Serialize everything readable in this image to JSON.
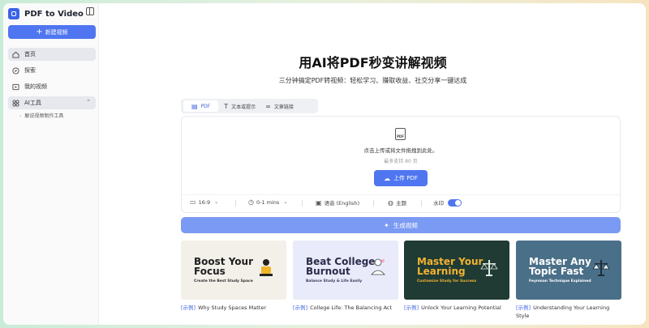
{
  "app": {
    "name": "PDF to Video"
  },
  "sidebar": {
    "new_button": "新建视频",
    "items": [
      {
        "label": "首页",
        "icon": "home-icon"
      },
      {
        "label": "探索",
        "icon": "explore-icon"
      },
      {
        "label": "我的视频",
        "icon": "video-icon"
      },
      {
        "label": "AI工具",
        "icon": "grid-icon"
      }
    ],
    "sub_items": [
      "解说视频制作工具"
    ]
  },
  "hero": {
    "title": "用AI将PDF秒变讲解视频",
    "subtitle": "三分钟搞定PDF转视频：轻松学习、赚取收益、社交分享一键达成"
  },
  "tabs": [
    "PDF",
    "文本或提示",
    "文章链接"
  ],
  "upload": {
    "icon_label": "PDF",
    "drop_text": "点击上传或将文件拖拽到此处。",
    "limit_text": "最多支持 80 页",
    "button": "上传 PDF"
  },
  "options": {
    "ratio": "16:9",
    "duration": "0-1 mins",
    "voice": "语音 (English)",
    "theme": "主题",
    "watermark": "水印",
    "watermark_on": true
  },
  "generate_button": "生成视频",
  "examples": [
    {
      "tag": "[示例]",
      "caption": "Why Study Spaces Matter",
      "thumb_title": "Boost Your Focus",
      "thumb_sub": "Create the Best Study Space"
    },
    {
      "tag": "[示例]",
      "caption": "College Life: The Balancing Act",
      "thumb_title": "Beat College Burnout",
      "thumb_sub": "Balance Study & Life Easily"
    },
    {
      "tag": "[示例]",
      "caption": "Unlock Your Learning Potential",
      "thumb_title": "Master Your Learning",
      "thumb_sub": "Customize Study for Success"
    },
    {
      "tag": "[示例]",
      "caption": "Understanding Your Learning Style",
      "thumb_title": "Master Any Topic Fast",
      "thumb_sub": "Feynman Technique Explained"
    }
  ],
  "colors": {
    "accent": "#4f76f0",
    "generate": "#7b9af3"
  }
}
